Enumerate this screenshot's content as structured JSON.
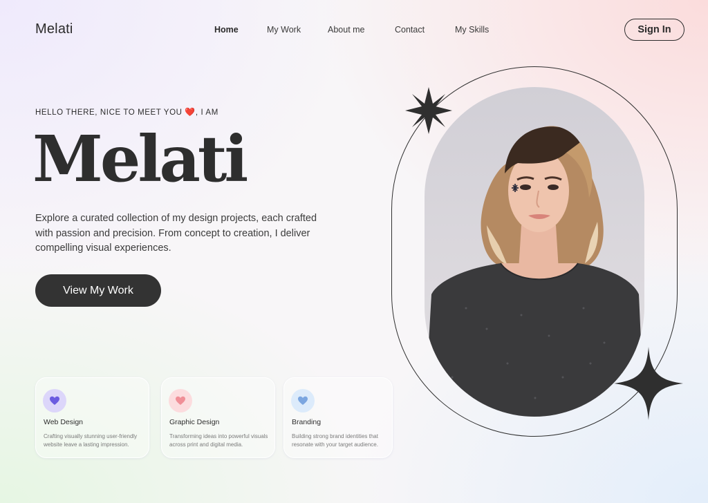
{
  "brand": {
    "name": "Melati"
  },
  "nav": {
    "items": [
      {
        "label": "Home",
        "active": true
      },
      {
        "label": "My Work",
        "active": false
      },
      {
        "label": "About me",
        "active": false
      },
      {
        "label": "Contact",
        "active": false
      },
      {
        "label": "My Skills",
        "active": false
      }
    ],
    "signin_label": "Sign In"
  },
  "hero": {
    "greeting_before": "HELLO THERE, NICE TO MEET YOU ",
    "greeting_heart": "❤️",
    "greeting_after": ", I AM",
    "name": "Melati",
    "intro": "Explore a curated collection of my design projects, each crafted with passion and precision. From concept to creation, I deliver compelling visual experiences.",
    "cta_label": "View My Work"
  },
  "services": [
    {
      "title": "Web Design",
      "description": "Crafting visually stunning user-friendly website leave a lasting impression.",
      "icon": "heart-icon",
      "icon_color": "#6b5ce0",
      "badge_color": "#dcd6fa"
    },
    {
      "title": "Graphic Design",
      "description": "Transforming ideas into powerful visuals across print and digital media.",
      "icon": "heart-icon",
      "icon_color": "#f08f97",
      "badge_color": "#fcdcde"
    },
    {
      "title": "Branding",
      "description": "Building strong brand identities that resonate with your target audience.",
      "icon": "heart-icon",
      "icon_color": "#7ba6e0",
      "badge_color": "#dcebfb"
    }
  ],
  "colors": {
    "text": "#2b2b2b",
    "button": "#333333",
    "button_text": "#ffffff"
  }
}
